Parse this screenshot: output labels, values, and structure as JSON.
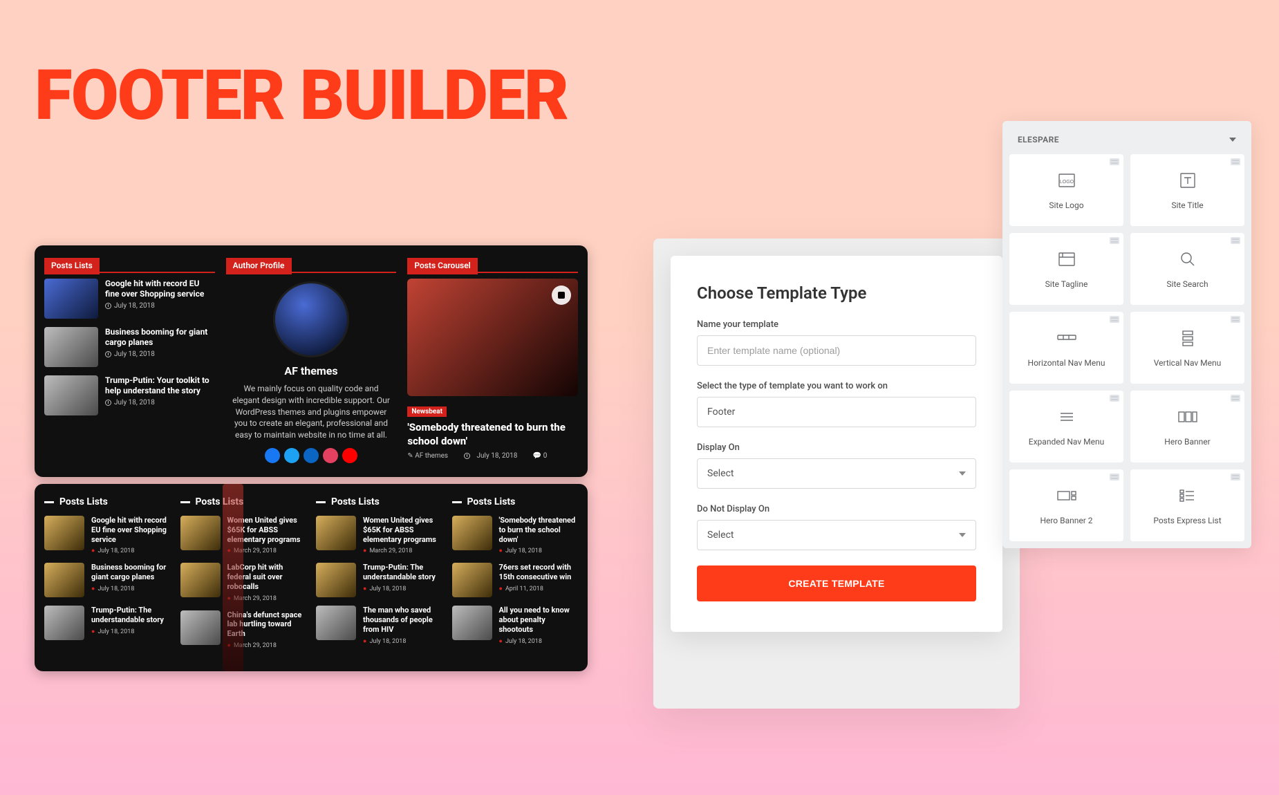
{
  "page_title": "FOOTER BUILDER",
  "panel1": {
    "tabs": [
      "Posts Lists",
      "Author Profile",
      "Posts Carousel"
    ],
    "col_posts": [
      {
        "title": "Google hit with record EU fine over Shopping service",
        "date": "July 18, 2018"
      },
      {
        "title": "Business booming for giant cargo planes",
        "date": "July 18, 2018"
      },
      {
        "title": "Trump-Putin: Your toolkit to help understand the story",
        "date": "July 18, 2018"
      }
    ],
    "author": {
      "name": "AF themes",
      "bio": "We mainly focus on quality code and elegant design with incredible support. Our WordPress themes and plugins empower you to create an elegant, professional and easy to maintain website in no time at all."
    },
    "carousel": {
      "tag": "Newsbeat",
      "title": "'Somebody threatened to burn the school down'",
      "by": "AF themes",
      "date": "July 18, 2018",
      "comments": "0"
    }
  },
  "panel2": {
    "col_title": "Posts Lists",
    "cols": [
      [
        {
          "title": "Google hit with record EU fine over Shopping service",
          "date": "July 18, 2018"
        },
        {
          "title": "Business booming for giant cargo planes",
          "date": "July 18, 2018"
        },
        {
          "title": "Trump-Putin: The understandable story",
          "date": "July 18, 2018"
        }
      ],
      [
        {
          "title": "Women United gives $65K for ABSS elementary programs",
          "date": "March 29, 2018"
        },
        {
          "title": "LabCorp hit with federal suit over robocalls",
          "date": "March 29, 2018"
        },
        {
          "title": "China's defunct space lab hurtling toward Earth",
          "date": "March 29, 2018"
        }
      ],
      [
        {
          "title": "Women United gives $65K for ABSS elementary programs",
          "date": "March 29, 2018"
        },
        {
          "title": "Trump-Putin: The understandable story",
          "date": "July 18, 2018"
        },
        {
          "title": "The man who saved thousands of people from HIV",
          "date": "July 18, 2018"
        }
      ],
      [
        {
          "title": "'Somebody threatened to burn the school down'",
          "date": "July 18, 2018"
        },
        {
          "title": "76ers set record with 15th consecutive win",
          "date": "April 11, 2018"
        },
        {
          "title": "All you need to know about penalty shootouts",
          "date": "July 18, 2018"
        }
      ]
    ]
  },
  "form": {
    "title": "Choose Template Type",
    "name_label": "Name your template",
    "name_placeholder": "Enter template name (optional)",
    "type_label": "Select the type of template you want to work on",
    "type_value": "Footer",
    "display_on_label": "Display On",
    "display_on_value": "Select",
    "not_display_on_label": "Do Not Display On",
    "not_display_on_value": "Select",
    "submit": "CREATE TEMPLATE"
  },
  "widgets": {
    "header": "ELESPARE",
    "items": [
      {
        "label": "Site Logo",
        "icon": "logo"
      },
      {
        "label": "Site Title",
        "icon": "title"
      },
      {
        "label": "Site Tagline",
        "icon": "tagline"
      },
      {
        "label": "Site Search",
        "icon": "search"
      },
      {
        "label": "Horizontal Nav Menu",
        "icon": "hmenu"
      },
      {
        "label": "Vertical Nav Menu",
        "icon": "vmenu"
      },
      {
        "label": "Expanded Nav Menu",
        "icon": "emenu"
      },
      {
        "label": "Hero Banner",
        "icon": "hero"
      },
      {
        "label": "Hero Banner 2",
        "icon": "hero2"
      },
      {
        "label": "Posts Express List",
        "icon": "express"
      }
    ]
  }
}
